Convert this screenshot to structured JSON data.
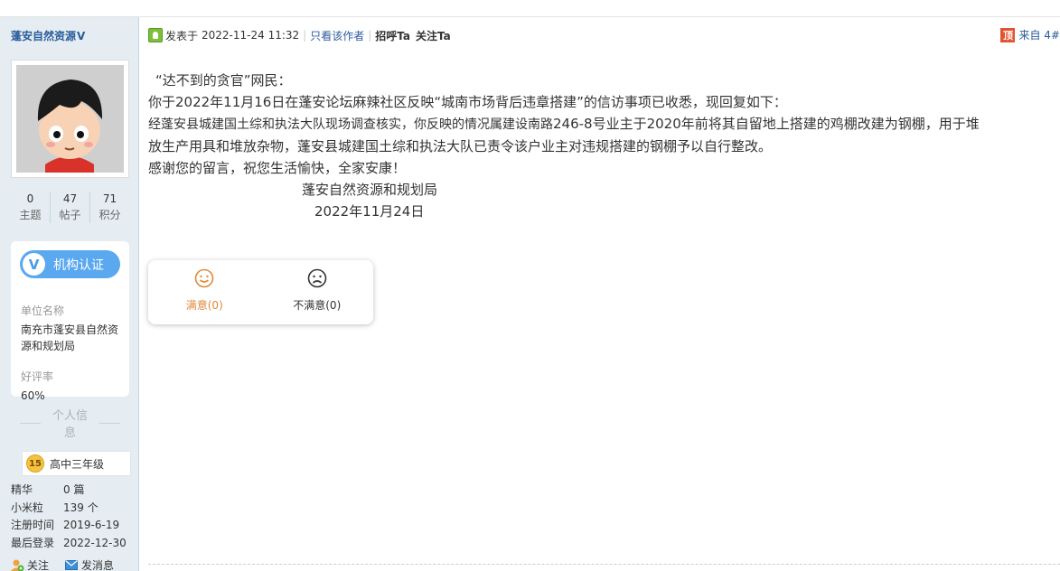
{
  "author": {
    "name": "蓬安自然资源",
    "verified_mark": "V",
    "stats": [
      {
        "value": "0",
        "label": "主题"
      },
      {
        "value": "47",
        "label": "帖子"
      },
      {
        "value": "71",
        "label": "积分"
      }
    ],
    "org": {
      "badge_label": "机构认证",
      "unit_label": "单位名称",
      "unit_value": "南充市蓬安县自然资源和规划局",
      "rating_label": "好评率",
      "rating_value": "60%"
    },
    "section_title": "个人信息",
    "level": {
      "number": "15",
      "label": "高中三年级"
    },
    "info": [
      {
        "key": "精华",
        "value": "0 篇"
      },
      {
        "key": "小米粒",
        "value": "139 个"
      },
      {
        "key": "注册时间",
        "value": "2019-6-19"
      },
      {
        "key": "最后登录",
        "value": "2022-12-30"
      }
    ],
    "actions": {
      "follow": "关注",
      "message": "发消息"
    }
  },
  "post": {
    "posted_prefix": "发表于",
    "posted_time": "2022-11-24 11:32",
    "only_author": "只看该作者",
    "greet": "招呼Ta",
    "follow": "关注Ta",
    "top_icon": "顶",
    "floor": "来自 4#",
    "body": {
      "line1": "“达不到的贪官”网民：",
      "line2": "你于2022年11月16日在蓬安论坛麻辣社区反映“城南市场背后违章搭建”的信访事项已收悉，现回复如下：",
      "line3_serif": "经蓬安县城建国土综和执法大队现场调查核实，你反映的情况属建设南路",
      "line3_rest": "246-8号业主于2020年前将其自留地上搭建的鸡棚改建为钢棚，用于堆",
      "line4": "放生产用具和堆放杂物，蓬安县城建国土综和执法大队已责令该户业主对违规搭建的钢棚予以自行整改。",
      "line5": "感谢您的留言，祝您生活愉快，全家安康！",
      "signature": "蓬安自然资源和规划局",
      "date": "2022年11月24日"
    },
    "rating": {
      "satisfied": "满意(0)",
      "unsatisfied": "不满意(0)"
    }
  },
  "colors": {
    "sidebar_bg": "#e5edf2",
    "link": "#2a5b9b",
    "badge_blue": "#5aa8ef",
    "satisfied_orange": "#e08a3b"
  },
  "icons": [
    "online-status-icon",
    "top-icon",
    "smile-icon",
    "frown-icon",
    "level-badge-icon",
    "follow-icon",
    "message-icon",
    "avatar"
  ]
}
